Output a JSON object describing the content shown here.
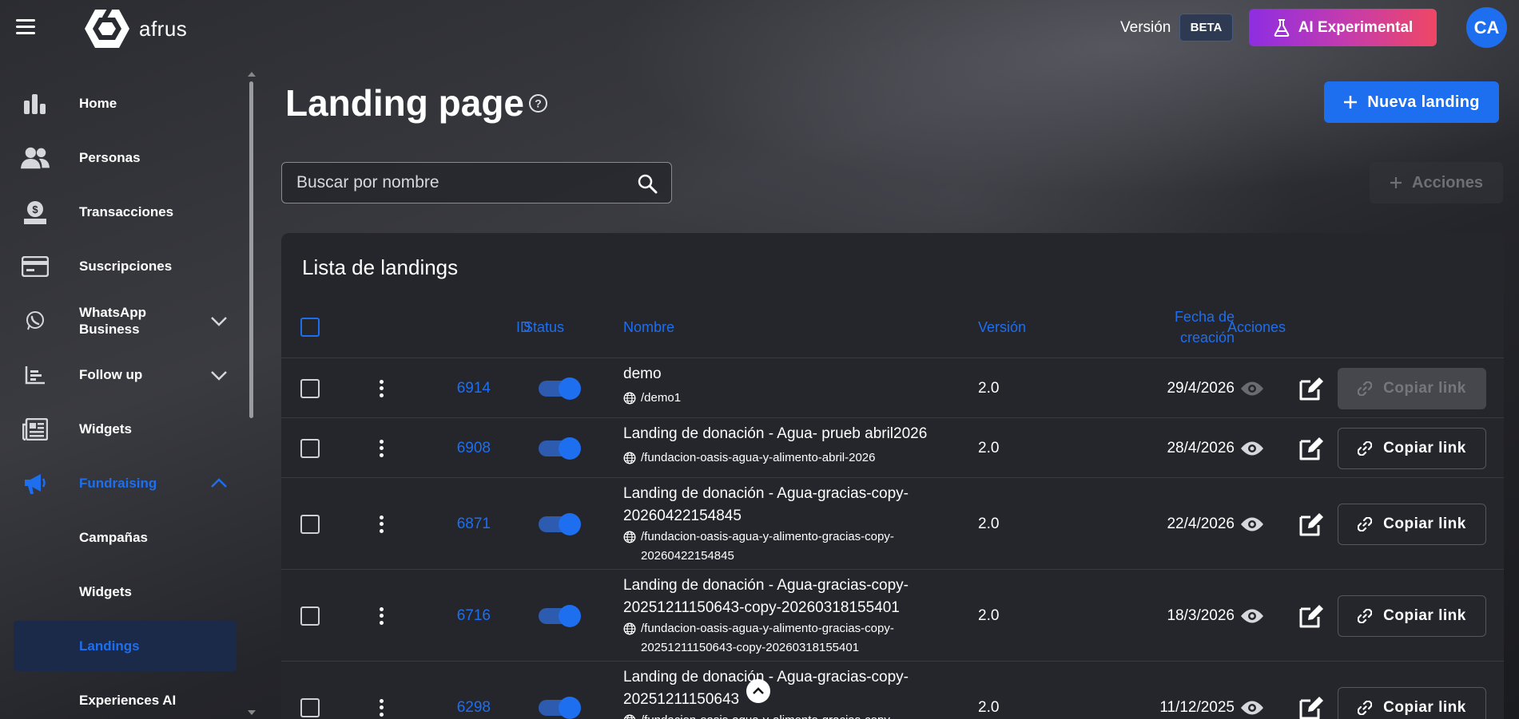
{
  "topbar": {
    "logo_text": "afrus",
    "version_label": "Versión",
    "beta_badge": "BETA",
    "ai_button_label": "AI Experimental",
    "avatar_initials": "CA"
  },
  "sidebar": {
    "items": [
      {
        "label": "Home",
        "icon": "bar-chart-icon"
      },
      {
        "label": "Personas",
        "icon": "people-icon"
      },
      {
        "label": "Transacciones",
        "icon": "money-hand-icon"
      },
      {
        "label": "Suscripciones",
        "icon": "credit-card-icon"
      },
      {
        "label": "WhatsApp Business",
        "icon": "whatsapp-icon"
      },
      {
        "label": "Follow up",
        "icon": "chart-list-icon"
      },
      {
        "label": "Widgets",
        "icon": "newspaper-icon"
      },
      {
        "label": "Fundraising",
        "icon": "megaphone-icon"
      },
      {
        "label": "Campañas"
      },
      {
        "label": "Widgets"
      },
      {
        "label": "Landings"
      },
      {
        "label": "Experiences AI"
      }
    ]
  },
  "page": {
    "title": "Landing page",
    "new_button_label": "Nueva landing",
    "search_placeholder": "Buscar por nombre",
    "actions_label": "Acciones"
  },
  "table": {
    "title": "Lista de landings",
    "headers": {
      "id": "ID",
      "status": "Status",
      "name": "Nombre",
      "version": "Versión",
      "date_line1": "Fecha de",
      "date_line2": "creación",
      "actions": "Acciones"
    },
    "copy_label": "Copiar link",
    "rows": [
      {
        "id": "6914",
        "name": "demo",
        "path": "/demo1",
        "version": "2.0",
        "date": "29/4/2026",
        "status_on": true
      },
      {
        "id": "6908",
        "name": "Landing de donación - Agua- prueb abril2026",
        "path": "/fundacion-oasis-agua-y-alimento-abril-2026",
        "version": "2.0",
        "date": "28/4/2026",
        "status_on": true
      },
      {
        "id": "6871",
        "name": "Landing de donación - Agua-gracias-copy-20260422154845",
        "path": "/fundacion-oasis-agua-y-alimento-gracias-copy-20260422154845",
        "version": "2.0",
        "date": "22/4/2026",
        "status_on": true
      },
      {
        "id": "6716",
        "name": "Landing de donación - Agua-gracias-copy-20251211150643-copy-20260318155401",
        "path": "/fundacion-oasis-agua-y-alimento-gracias-copy-20251211150643-copy-20260318155401",
        "version": "2.0",
        "date": "18/3/2026",
        "status_on": true
      },
      {
        "id": "6298",
        "name": "Landing de donación - Agua-gracias-copy-20251211150643",
        "path": "/fundacion-oasis-agua-y-alimento-gracias-copy-",
        "version": "2.0",
        "date": "11/12/2025",
        "status_on": true
      }
    ]
  },
  "colors": {
    "accent": "#1e6ef0",
    "background": "#1c1d22",
    "card": "#25262b"
  }
}
